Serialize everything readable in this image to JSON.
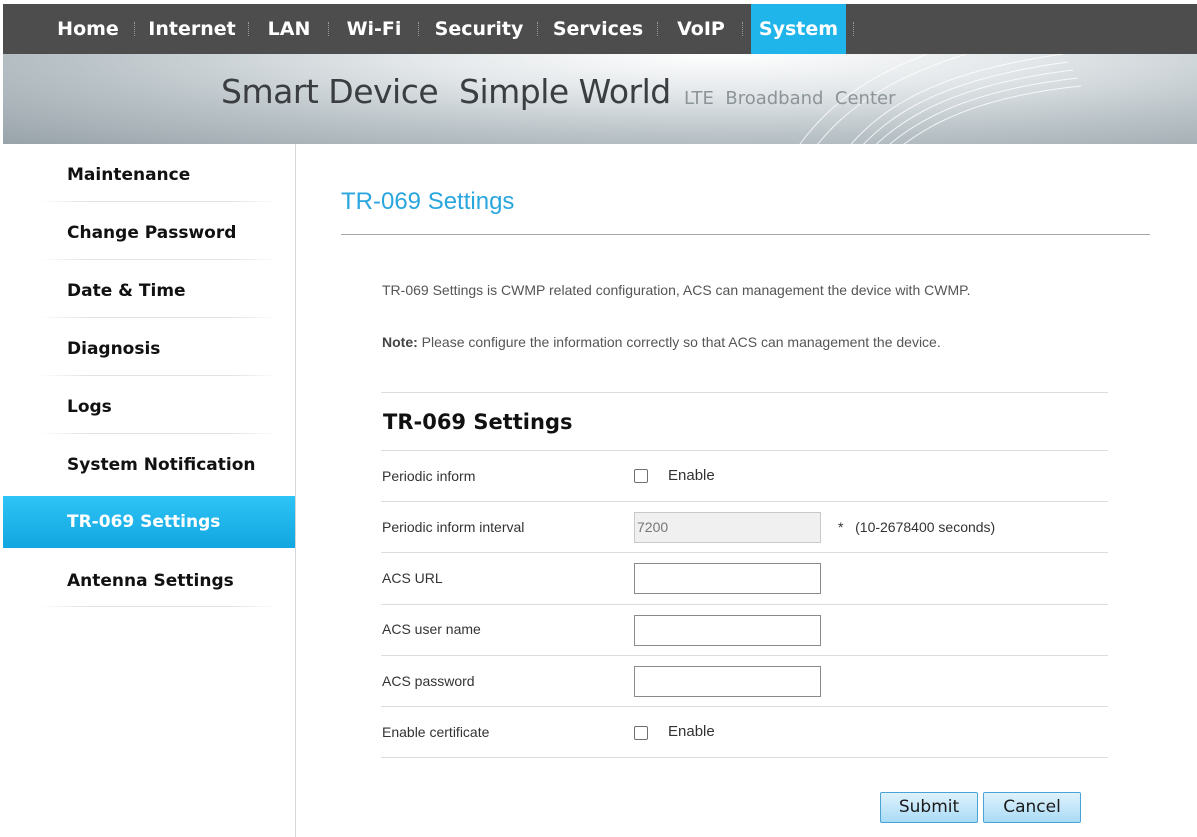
{
  "nav": {
    "items": [
      {
        "label": "Home"
      },
      {
        "label": "Internet"
      },
      {
        "label": "LAN"
      },
      {
        "label": "Wi-Fi"
      },
      {
        "label": "Security"
      },
      {
        "label": "Services"
      },
      {
        "label": "VoIP"
      },
      {
        "label": "System",
        "active": true
      }
    ]
  },
  "banner": {
    "slogan_part1": "Smart Device",
    "slogan_part2": "Simple World",
    "subtitle": "LTE  Broadband  Center"
  },
  "sidebar": {
    "items": [
      {
        "label": "Maintenance"
      },
      {
        "label": "Change Password"
      },
      {
        "label": "Date & Time"
      },
      {
        "label": "Diagnosis"
      },
      {
        "label": "Logs"
      },
      {
        "label": "System Notification"
      },
      {
        "label": "TR-069 Settings",
        "active": true
      },
      {
        "label": "Antenna Settings"
      }
    ]
  },
  "main": {
    "page_title": "TR-069 Settings",
    "description": "TR-069 Settings is CWMP related configuration, ACS can management the device with CWMP.",
    "note_label": "Note:",
    "note_text": " Please configure the information correctly so that ACS can management the device.",
    "section_title": "TR-069 Settings",
    "fields": {
      "periodic_inform": {
        "label": "Periodic inform",
        "checkbox_label": "Enable",
        "checked": false
      },
      "periodic_interval": {
        "label": "Periodic inform interval",
        "value": "7200",
        "required_mark": "*",
        "hint": "(10-2678400 seconds)",
        "disabled": true
      },
      "acs_url": {
        "label": "ACS URL",
        "value": ""
      },
      "acs_username": {
        "label": "ACS user name",
        "value": ""
      },
      "acs_password": {
        "label": "ACS password",
        "value": ""
      },
      "enable_certificate": {
        "label": "Enable certificate",
        "checkbox_label": "Enable",
        "checked": false
      }
    },
    "buttons": {
      "submit": "Submit",
      "cancel": "Cancel"
    }
  },
  "colors": {
    "accent": "#1fb4ea",
    "nav_bg": "#4d4d4d",
    "title": "#2aa6de"
  }
}
